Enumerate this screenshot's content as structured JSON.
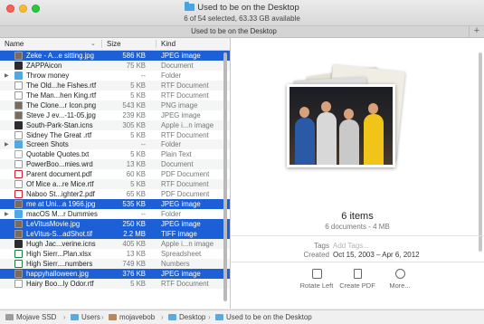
{
  "window": {
    "title": "Used to be on the Desktop",
    "status": "6 of 54 selected, 63.33 GB available",
    "tab_title": "Used to be on the Desktop"
  },
  "list": {
    "headers": {
      "name": "Name",
      "size": "Size",
      "kind": "Kind"
    },
    "rows": [
      {
        "name": "Zeke - A...e sitting.jpg",
        "size": "586 KB",
        "kind": "JPEG image",
        "icon": "image-icon",
        "sel": true,
        "disc": false
      },
      {
        "name": "ZAPPAicon",
        "size": "75 KB",
        "kind": "Document",
        "icon": "app-icon",
        "sel": false,
        "disc": false
      },
      {
        "name": "Throw money",
        "size": "--",
        "kind": "Folder",
        "icon": "folder-icon",
        "sel": false,
        "disc": true
      },
      {
        "name": "The Old...he Fishes.rtf",
        "size": "5 KB",
        "kind": "RTF Document",
        "icon": "doc-icon",
        "sel": false,
        "disc": false
      },
      {
        "name": "The Man...hen King.rtf",
        "size": "5 KB",
        "kind": "RTF Document",
        "icon": "doc-icon",
        "sel": false,
        "disc": false
      },
      {
        "name": "The Clone...r Icon.png",
        "size": "543 KB",
        "kind": "PNG image",
        "icon": "image-icon",
        "sel": false,
        "disc": false
      },
      {
        "name": "Steve J ev...-11-05.jpg",
        "size": "239 KB",
        "kind": "JPEG image",
        "icon": "image-icon",
        "sel": false,
        "disc": false
      },
      {
        "name": "South-Park-Stan.icns",
        "size": "305 KB",
        "kind": "Apple i...n image",
        "icon": "app-icon",
        "sel": false,
        "disc": false
      },
      {
        "name": "Sidney The Great .rtf",
        "size": "5 KB",
        "kind": "RTF Document",
        "icon": "doc-icon",
        "sel": false,
        "disc": false
      },
      {
        "name": "Screen Shots",
        "size": "--",
        "kind": "Folder",
        "icon": "folder-icon",
        "sel": false,
        "disc": true
      },
      {
        "name": "Quotable Quotes.txt",
        "size": "5 KB",
        "kind": "Plain Text",
        "icon": "text-icon",
        "sel": false,
        "disc": false
      },
      {
        "name": "PowerBoo...mies.wrd",
        "size": "13 KB",
        "kind": "Document",
        "icon": "doc-icon",
        "sel": false,
        "disc": false
      },
      {
        "name": "Parent document.pdf",
        "size": "60 KB",
        "kind": "PDF Document",
        "icon": "pdf-icon",
        "sel": false,
        "disc": false
      },
      {
        "name": "Of Mice a...re Mice.rtf",
        "size": "5 KB",
        "kind": "RTF Document",
        "icon": "doc-icon",
        "sel": false,
        "disc": false
      },
      {
        "name": "Naboo St...ighter2.pdf",
        "size": "65 KB",
        "kind": "PDF Document",
        "icon": "pdf-icon",
        "sel": false,
        "disc": false
      },
      {
        "name": "me at Uni...a 1966.jpg",
        "size": "535 KB",
        "kind": "JPEG image",
        "icon": "image-icon",
        "sel": true,
        "disc": false
      },
      {
        "name": "macOS M...r Dummies",
        "size": "--",
        "kind": "Folder",
        "icon": "folder-icon",
        "sel": false,
        "disc": true
      },
      {
        "name": "LeVitusMovie.jpg",
        "size": "250 KB",
        "kind": "JPEG image",
        "icon": "image-icon",
        "sel": true,
        "disc": false
      },
      {
        "name": "LeVitus-S...adShot.tif",
        "size": "2.2 MB",
        "kind": "TIFF image",
        "icon": "image-icon",
        "sel": true,
        "disc": false
      },
      {
        "name": "Hugh Jac...verine.icns",
        "size": "405 KB",
        "kind": "Apple i...n image",
        "icon": "app-icon",
        "sel": false,
        "disc": false
      },
      {
        "name": "High Sierr...Plan.xlsx",
        "size": "13 KB",
        "kind": "Spreadsheet",
        "icon": "spreadsheet-icon",
        "sel": false,
        "disc": false
      },
      {
        "name": "High Sierr....numbers",
        "size": "749 KB",
        "kind": "Numbers",
        "icon": "spreadsheet-icon",
        "sel": false,
        "disc": false
      },
      {
        "name": "happyhalloween.jpg",
        "size": "376 KB",
        "kind": "JPEG image",
        "icon": "image-icon",
        "sel": true,
        "disc": false
      },
      {
        "name": "Hairy Boo...ly Odor.rtf",
        "size": "5 KB",
        "kind": "RTF Document",
        "icon": "doc-icon",
        "sel": false,
        "disc": false
      }
    ]
  },
  "preview": {
    "count": "6 items",
    "subtitle": "6 documents - 4 MB",
    "tags_label": "Tags",
    "tags_placeholder": "Add Tags...",
    "created_label": "Created",
    "created_value": "Oct 15, 2003 – Apr 6, 2012",
    "actions": {
      "rotate": "Rotate Left",
      "pdf": "Create PDF",
      "more": "More..."
    }
  },
  "pathbar": [
    "Mojave SSD",
    "Users",
    "mojavebob",
    "Desktop",
    "Used to be on the Desktop"
  ],
  "colors": {
    "selection": "#1d5fd6",
    "folder": "#52a8e2"
  }
}
